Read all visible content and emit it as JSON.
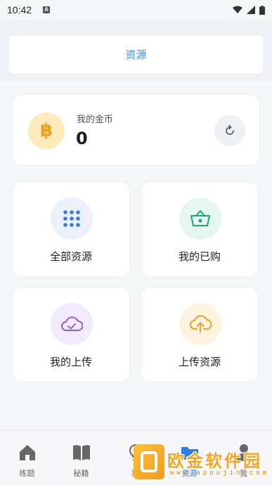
{
  "status_bar": {
    "time": "10:42",
    "notification_letter": "A"
  },
  "header": {
    "title": "资源"
  },
  "coins": {
    "label": "我的金币",
    "value": "0",
    "coin_symbol": "฿",
    "coin_color": "#f0a020"
  },
  "cards": [
    {
      "label": "全部资源",
      "icon": "grid-icon",
      "icon_color": "#3a7bd5",
      "bg": "#eaf1fc"
    },
    {
      "label": "我的已购",
      "icon": "basket-icon",
      "icon_color": "#1ea37b",
      "bg": "#e4f6ef"
    },
    {
      "label": "我的上传",
      "icon": "cloud-check-icon",
      "icon_color": "#9060d0",
      "bg": "#f1eafa"
    },
    {
      "label": "上传资源",
      "icon": "cloud-upload-icon",
      "icon_color": "#f0a020",
      "bg": "#fdf3e0"
    }
  ],
  "tabs": [
    {
      "label": "练题",
      "icon": "home-icon"
    },
    {
      "label": "秘籍",
      "icon": "book-icon"
    },
    {
      "label": "需",
      "icon": "bulb-icon"
    },
    {
      "label": "资源",
      "icon": "folder-icon"
    },
    {
      "label": "我",
      "icon": "user-icon"
    }
  ],
  "watermark": {
    "text": "欧金软件园",
    "url": "www.apoujin.com"
  }
}
